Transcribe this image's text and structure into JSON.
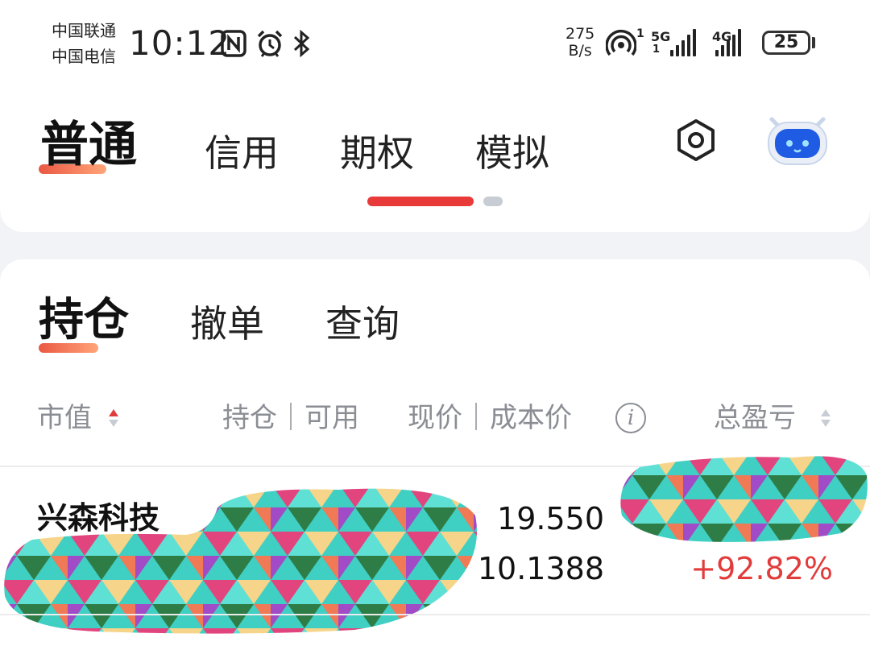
{
  "status_bar": {
    "carrier_1": "中国联通",
    "carrier_2": "中国电信",
    "time": "10:12",
    "net_speed_value": "275",
    "net_speed_unit": "B/s",
    "hotspot_count": "1",
    "sim1_label": "5G",
    "sim1_sub": "1",
    "sim2_label": "4G",
    "battery": "25",
    "icons": [
      "nfc-icon",
      "alarm-icon",
      "bluetooth-icon",
      "hotspot-icon",
      "signal-icon",
      "battery-icon"
    ]
  },
  "account_tabs": {
    "items": [
      {
        "label": "普通",
        "active": true
      },
      {
        "label": "信用",
        "active": false
      },
      {
        "label": "期权",
        "active": false
      },
      {
        "label": "模拟",
        "active": false
      }
    ],
    "accent_color": "#e93a3a"
  },
  "holdings": {
    "tabs": [
      {
        "label": "持仓",
        "active": true
      },
      {
        "label": "撤单",
        "active": false
      },
      {
        "label": "查询",
        "active": false
      }
    ],
    "columns": {
      "market_value": "市值",
      "position_available": "持仓｜可用",
      "price_cost": "现价｜成本价",
      "total_pl": "总盈亏"
    },
    "rows": [
      {
        "name": "兴森科技",
        "price": "19.550",
        "cost": "10.1388",
        "pl_percent": "+92.82%"
      }
    ]
  },
  "colors": {
    "gain": "#e23b3b",
    "muted_text": "#8a8d93"
  }
}
